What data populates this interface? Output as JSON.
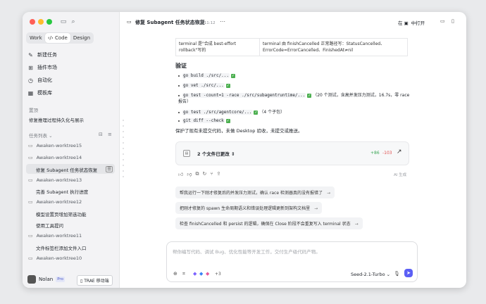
{
  "sidebar": {
    "tabs": [
      "Work",
      "Code",
      "Design"
    ],
    "active_tab": "Code",
    "nav": [
      {
        "label": "新建任务",
        "icon": "new-task-icon"
      },
      {
        "label": "插件市场",
        "icon": "plugin-icon"
      },
      {
        "label": "自动化",
        "icon": "automation-icon"
      },
      {
        "label": "模板库",
        "icon": "template-icon"
      }
    ],
    "pinned_label": "置顶",
    "pinned_item": "修复推理过程持久化与展示",
    "task_list_label": "任务列表",
    "groups": [
      {
        "folder": "Awaken-worktree15",
        "tasks": []
      },
      {
        "folder": "Awaken-worktree14",
        "tasks": [
          "修复 Subagent 任务状态恢复"
        ]
      },
      {
        "folder": "Awaken-worktree13",
        "tasks": [
          "完善 Subagent 执行进度"
        ]
      },
      {
        "folder": "Awaken-worktree12",
        "tasks": [
          "模型设置页增加筛选功能",
          "使用工具提问"
        ]
      },
      {
        "folder": "Awaken-worktree11",
        "tasks": [
          "文件标签栏添加文件入口"
        ]
      },
      {
        "folder": "Awaken-worktree10",
        "tasks": []
      }
    ],
    "user": {
      "name": "Nolan",
      "badge": "Pro"
    },
    "mode_button": "TRAE 移动端"
  },
  "header": {
    "title": "修复 Subagent 任务状态恢复",
    "time": "昨天 11:12",
    "open_label": "在",
    "open_target": "中打开"
  },
  "content": {
    "table_row": {
      "left": "terminal 是\"合成 best-effort rollback\"写的",
      "right": "terminal 由 finishCancelled 正常路径写：StatusCancelled、ErrorCode=ErrorCancelled、FinishedAt≠nil"
    },
    "section_title": "验证",
    "bullets": [
      {
        "code": "go build ./src/...",
        "suffix": ""
      },
      {
        "code": "go vet ./src/...",
        "suffix": ""
      },
      {
        "code": "go test -count=1 -race ./src/subagentruntime/...",
        "suffix": "（20 个测试，含高并发压力测试，16.7s，零 race 报告）"
      },
      {
        "code": "go test ./src/agentcore/...",
        "suffix": "（4 个子包）"
      },
      {
        "code": "git diff --check",
        "suffix": ""
      }
    ],
    "summary": "保护了现有未提交代码，未做 Desktop 验收，未提交或推送。",
    "files_changed": "2 个文件已更改",
    "additions": "+86",
    "deletions": "-103",
    "ai_label": "AI 生成",
    "suggestions": [
      "帮我运行一下刚才修复后的并发压力测试，确认 race 检测器真的没有报错了",
      "把刚才修复的 spawn 生命周期语义和错误处理逻辑更新到架构文档里",
      "检查 finishCancelled 和 persist 的逻辑，确保在 Close 阶段不会重复写入 terminal 状态"
    ]
  },
  "composer": {
    "placeholder": "帮你编写代码、调试 Bug、优化性能等开发工作，交付生产级代码产物。",
    "attach_count": "+3",
    "model": "Seed-2.1-Turbo"
  }
}
